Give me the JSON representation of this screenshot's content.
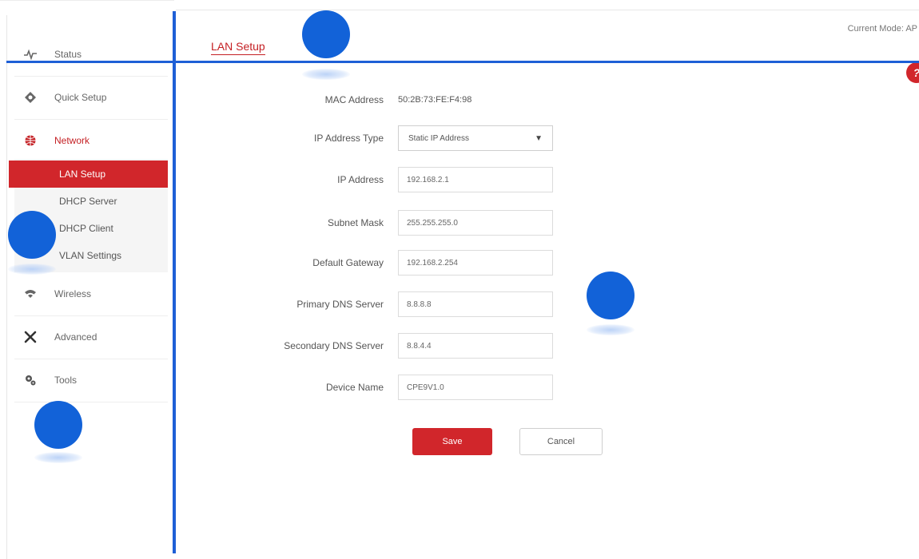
{
  "sidebar": {
    "items": [
      {
        "label": "Status",
        "icon": "pulse-icon"
      },
      {
        "label": "Quick Setup",
        "icon": "quick-setup-icon"
      },
      {
        "label": "Network",
        "icon": "network-icon"
      },
      {
        "label": "Wireless",
        "icon": "wifi-icon"
      },
      {
        "label": "Advanced",
        "icon": "tools-cross-icon"
      },
      {
        "label": "Tools",
        "icon": "gears-icon"
      }
    ],
    "network_submenu": [
      {
        "label": "LAN Setup"
      },
      {
        "label": "DHCP Server"
      },
      {
        "label": "DHCP Client"
      },
      {
        "label": "VLAN Settings"
      }
    ]
  },
  "header": {
    "tab": "LAN Setup",
    "mode": "Current Mode: AP"
  },
  "form": {
    "mac_label": "MAC Address",
    "mac_value": "50:2B:73:FE:F4:98",
    "ip_type_label": "IP Address Type",
    "ip_type_value": "Static IP Address",
    "ip_label": "IP Address",
    "ip_value": "192.168.2.1",
    "mask_label": "Subnet Mask",
    "mask_value": "255.255.255.0",
    "gateway_label": "Default Gateway",
    "gateway_value": "192.168.2.254",
    "dns1_label": "Primary DNS Server",
    "dns1_value": "8.8.8.8",
    "dns2_label": "Secondary DNS Server",
    "dns2_value": "8.8.4.4",
    "name_label": "Device Name",
    "name_value": "CPE9V1.0"
  },
  "buttons": {
    "save": "Save",
    "cancel": "Cancel"
  },
  "colors": {
    "accent": "#d1262b",
    "overlay": "#1e5fd6"
  }
}
